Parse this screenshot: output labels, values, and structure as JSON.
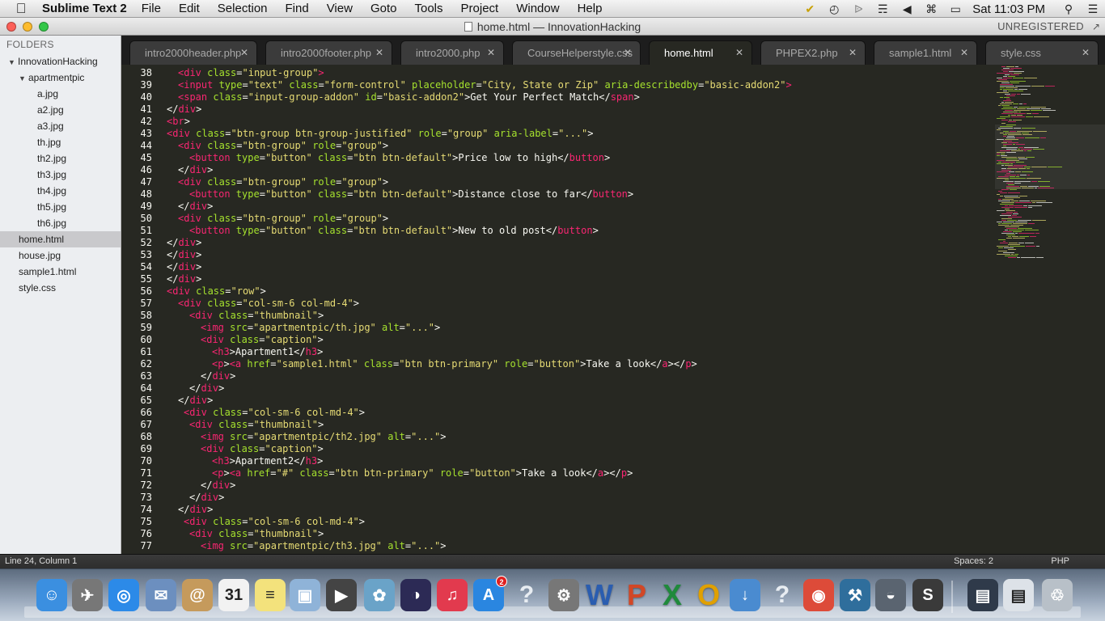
{
  "menubar": {
    "app_name": "Sublime Text 2",
    "items": [
      "File",
      "Edit",
      "Selection",
      "Find",
      "View",
      "Goto",
      "Tools",
      "Project",
      "Window",
      "Help"
    ],
    "clock": "Sat 11:03 PM"
  },
  "window": {
    "title": "home.html — InnovationHacking",
    "registration": "UNREGISTERED"
  },
  "sidebar": {
    "heading": "FOLDERS",
    "tree": [
      {
        "label": "InnovationHacking",
        "depth": 0,
        "expanded": true
      },
      {
        "label": "apartmentpic",
        "depth": 1,
        "expanded": true
      },
      {
        "label": "a.jpg",
        "depth": 2
      },
      {
        "label": "a2.jpg",
        "depth": 2
      },
      {
        "label": "a3.jpg",
        "depth": 2
      },
      {
        "label": "th.jpg",
        "depth": 2
      },
      {
        "label": "th2.jpg",
        "depth": 2
      },
      {
        "label": "th3.jpg",
        "depth": 2
      },
      {
        "label": "th4.jpg",
        "depth": 2
      },
      {
        "label": "th5.jpg",
        "depth": 2
      },
      {
        "label": "th6.jpg",
        "depth": 2
      },
      {
        "label": "home.html",
        "depth": 1,
        "selected": true
      },
      {
        "label": "house.jpg",
        "depth": 1
      },
      {
        "label": "sample1.html",
        "depth": 1
      },
      {
        "label": "style.css",
        "depth": 1
      }
    ]
  },
  "tabs": [
    {
      "label": "intro2000header.php"
    },
    {
      "label": "intro2000footer.php"
    },
    {
      "label": "intro2000.php"
    },
    {
      "label": "CourseHelperstyle.css"
    },
    {
      "label": "home.html",
      "active": true
    },
    {
      "label": "PHPEX2.php"
    },
    {
      "label": "sample1.html"
    },
    {
      "label": "style.css"
    }
  ],
  "code_lines": [
    {
      "n": "38",
      "indent": 2,
      "tokens": [
        [
          "tn",
          "<div"
        ],
        [
          "at",
          " class"
        ],
        [
          "tx",
          "="
        ],
        [
          "sv",
          "\"input-group\""
        ],
        [
          "tn",
          ">"
        ]
      ]
    },
    {
      "n": "39",
      "indent": 2,
      "tokens": [
        [
          "tn",
          "<input"
        ],
        [
          "at",
          " type"
        ],
        [
          "tx",
          "="
        ],
        [
          "sv",
          "\"text\""
        ],
        [
          "at",
          " class"
        ],
        [
          "tx",
          "="
        ],
        [
          "sv",
          "\"form-control\""
        ],
        [
          "at",
          " placeholder"
        ],
        [
          "tx",
          "="
        ],
        [
          "sv",
          "\"City, State or Zip\""
        ],
        [
          "at",
          " aria-describedby"
        ],
        [
          "tx",
          "="
        ],
        [
          "sv",
          "\"basic-addon2\""
        ],
        [
          "tn",
          ">"
        ]
      ]
    },
    {
      "n": "40",
      "indent": 2,
      "tokens": [
        [
          "tn",
          "<span"
        ],
        [
          "at",
          " class"
        ],
        [
          "tx",
          "="
        ],
        [
          "sv",
          "\"input-group-addon\""
        ],
        [
          "at",
          " id"
        ],
        [
          "tx",
          "="
        ],
        [
          "sv",
          "\"basic-addon2\""
        ],
        [
          "tx",
          ">Get Your Perfect Match</"
        ],
        [
          "tn",
          "span"
        ],
        [
          "tx",
          ">"
        ]
      ]
    },
    {
      "n": "41",
      "indent": 0,
      "tokens": [
        [
          "tx",
          "</"
        ],
        [
          "tn",
          "div"
        ],
        [
          "tx",
          ">"
        ]
      ]
    },
    {
      "n": "42",
      "indent": 0,
      "tokens": [
        [
          "tn",
          "<br"
        ],
        [
          "tx",
          ">"
        ]
      ]
    },
    {
      "n": "43",
      "indent": 0,
      "tokens": [
        [
          "tn",
          "<div"
        ],
        [
          "at",
          " class"
        ],
        [
          "tx",
          "="
        ],
        [
          "sv",
          "\"btn-group btn-group-justified\""
        ],
        [
          "at",
          " role"
        ],
        [
          "tx",
          "="
        ],
        [
          "sv",
          "\"group\""
        ],
        [
          "at",
          " aria-label"
        ],
        [
          "tx",
          "="
        ],
        [
          "sv",
          "\"...\""
        ],
        [
          "tx",
          ">"
        ]
      ]
    },
    {
      "n": "44",
      "indent": 2,
      "tokens": [
        [
          "tn",
          "<div"
        ],
        [
          "at",
          " class"
        ],
        [
          "tx",
          "="
        ],
        [
          "sv",
          "\"btn-group\""
        ],
        [
          "at",
          " role"
        ],
        [
          "tx",
          "="
        ],
        [
          "sv",
          "\"group\""
        ],
        [
          "tx",
          ">"
        ]
      ]
    },
    {
      "n": "45",
      "indent": 4,
      "tokens": [
        [
          "tn",
          "<button"
        ],
        [
          "at",
          " type"
        ],
        [
          "tx",
          "="
        ],
        [
          "sv",
          "\"button\""
        ],
        [
          "at",
          " class"
        ],
        [
          "tx",
          "="
        ],
        [
          "sv",
          "\"btn btn-default\""
        ],
        [
          "tx",
          ">Price low to high</"
        ],
        [
          "tn",
          "button"
        ],
        [
          "tx",
          ">"
        ]
      ]
    },
    {
      "n": "46",
      "indent": 2,
      "tokens": [
        [
          "tx",
          "</"
        ],
        [
          "tn",
          "div"
        ],
        [
          "tx",
          ">"
        ]
      ]
    },
    {
      "n": "47",
      "indent": 2,
      "tokens": [
        [
          "tn",
          "<div"
        ],
        [
          "at",
          " class"
        ],
        [
          "tx",
          "="
        ],
        [
          "sv",
          "\"btn-group\""
        ],
        [
          "at",
          " role"
        ],
        [
          "tx",
          "="
        ],
        [
          "sv",
          "\"group\""
        ],
        [
          "tx",
          ">"
        ]
      ]
    },
    {
      "n": "48",
      "indent": 4,
      "tokens": [
        [
          "tn",
          "<button"
        ],
        [
          "at",
          " type"
        ],
        [
          "tx",
          "="
        ],
        [
          "sv",
          "\"button\""
        ],
        [
          "at",
          " class"
        ],
        [
          "tx",
          "="
        ],
        [
          "sv",
          "\"btn btn-default\""
        ],
        [
          "tx",
          ">Distance close to far</"
        ],
        [
          "tn",
          "button"
        ],
        [
          "tx",
          ">"
        ]
      ]
    },
    {
      "n": "49",
      "indent": 2,
      "tokens": [
        [
          "tx",
          "</"
        ],
        [
          "tn",
          "div"
        ],
        [
          "tx",
          ">"
        ]
      ]
    },
    {
      "n": "50",
      "indent": 2,
      "tokens": [
        [
          "tn",
          "<div"
        ],
        [
          "at",
          " class"
        ],
        [
          "tx",
          "="
        ],
        [
          "sv",
          "\"btn-group\""
        ],
        [
          "at",
          " role"
        ],
        [
          "tx",
          "="
        ],
        [
          "sv",
          "\"group\""
        ],
        [
          "tx",
          ">"
        ]
      ]
    },
    {
      "n": "51",
      "indent": 4,
      "tokens": [
        [
          "tn",
          "<button"
        ],
        [
          "at",
          " type"
        ],
        [
          "tx",
          "="
        ],
        [
          "sv",
          "\"button\""
        ],
        [
          "at",
          " class"
        ],
        [
          "tx",
          "="
        ],
        [
          "sv",
          "\"btn btn-default\""
        ],
        [
          "tx",
          ">New to old post</"
        ],
        [
          "tn",
          "button"
        ],
        [
          "tx",
          ">"
        ]
      ]
    },
    {
      "n": "52",
      "indent": 0,
      "tokens": [
        [
          "tx",
          "</"
        ],
        [
          "tn",
          "div"
        ],
        [
          "tx",
          ">"
        ]
      ]
    },
    {
      "n": "53",
      "indent": 0,
      "tokens": [
        [
          "tx",
          "</"
        ],
        [
          "tn",
          "div"
        ],
        [
          "tx",
          ">"
        ]
      ]
    },
    {
      "n": "54",
      "indent": 0,
      "tokens": [
        [
          "tx",
          "</"
        ],
        [
          "tn",
          "div"
        ],
        [
          "tx",
          ">"
        ]
      ]
    },
    {
      "n": "55",
      "indent": 0,
      "tokens": [
        [
          "tx",
          "</"
        ],
        [
          "tn",
          "div"
        ],
        [
          "tx",
          ">"
        ]
      ]
    },
    {
      "n": "56",
      "indent": 0,
      "tokens": [
        [
          "tn",
          "<div"
        ],
        [
          "at",
          " class"
        ],
        [
          "tx",
          "="
        ],
        [
          "sv",
          "\"row\""
        ],
        [
          "tx",
          ">"
        ]
      ]
    },
    {
      "n": "57",
      "indent": 2,
      "tokens": [
        [
          "tn",
          "<div"
        ],
        [
          "at",
          " class"
        ],
        [
          "tx",
          "="
        ],
        [
          "sv",
          "\"col-sm-6 col-md-4\""
        ],
        [
          "tx",
          ">"
        ]
      ]
    },
    {
      "n": "58",
      "indent": 4,
      "tokens": [
        [
          "tn",
          "<div"
        ],
        [
          "at",
          " class"
        ],
        [
          "tx",
          "="
        ],
        [
          "sv",
          "\"thumbnail\""
        ],
        [
          "tx",
          ">"
        ]
      ]
    },
    {
      "n": "59",
      "indent": 6,
      "tokens": [
        [
          "tn",
          "<img"
        ],
        [
          "at",
          " src"
        ],
        [
          "tx",
          "="
        ],
        [
          "sv",
          "\"apartmentpic/th.jpg\""
        ],
        [
          "at",
          " alt"
        ],
        [
          "tx",
          "="
        ],
        [
          "sv",
          "\"...\""
        ],
        [
          "tx",
          ">"
        ]
      ]
    },
    {
      "n": "60",
      "indent": 6,
      "tokens": [
        [
          "tn",
          "<div"
        ],
        [
          "at",
          " class"
        ],
        [
          "tx",
          "="
        ],
        [
          "sv",
          "\"caption\""
        ],
        [
          "tx",
          ">"
        ]
      ]
    },
    {
      "n": "61",
      "indent": 8,
      "tokens": [
        [
          "tn",
          "<h3"
        ],
        [
          "tx",
          ">Apartment1</"
        ],
        [
          "tn",
          "h3"
        ],
        [
          "tx",
          ">"
        ]
      ]
    },
    {
      "n": "62",
      "indent": 8,
      "tokens": [
        [
          "tn",
          "<p"
        ],
        [
          "tx",
          ">"
        ],
        [
          "tn",
          "<a"
        ],
        [
          "at",
          " href"
        ],
        [
          "tx",
          "="
        ],
        [
          "sv",
          "\"sample1.html\""
        ],
        [
          "at",
          " class"
        ],
        [
          "tx",
          "="
        ],
        [
          "sv",
          "\"btn btn-primary\""
        ],
        [
          "at",
          " role"
        ],
        [
          "tx",
          "="
        ],
        [
          "sv",
          "\"button\""
        ],
        [
          "tx",
          ">Take a look</"
        ],
        [
          "tn",
          "a"
        ],
        [
          "tx",
          "></"
        ],
        [
          "tn",
          "p"
        ],
        [
          "tx",
          ">"
        ]
      ]
    },
    {
      "n": "63",
      "indent": 6,
      "tokens": [
        [
          "tx",
          "</"
        ],
        [
          "tn",
          "div"
        ],
        [
          "tx",
          ">"
        ]
      ]
    },
    {
      "n": "64",
      "indent": 4,
      "tokens": [
        [
          "tx",
          "</"
        ],
        [
          "tn",
          "div"
        ],
        [
          "tx",
          ">"
        ]
      ]
    },
    {
      "n": "65",
      "indent": 2,
      "tokens": [
        [
          "tx",
          "</"
        ],
        [
          "tn",
          "div"
        ],
        [
          "tx",
          ">"
        ]
      ]
    },
    {
      "n": "66",
      "indent": 3,
      "tokens": [
        [
          "tn",
          "<div"
        ],
        [
          "at",
          " class"
        ],
        [
          "tx",
          "="
        ],
        [
          "sv",
          "\"col-sm-6 col-md-4\""
        ],
        [
          "tx",
          ">"
        ]
      ]
    },
    {
      "n": "67",
      "indent": 4,
      "tokens": [
        [
          "tn",
          "<div"
        ],
        [
          "at",
          " class"
        ],
        [
          "tx",
          "="
        ],
        [
          "sv",
          "\"thumbnail\""
        ],
        [
          "tx",
          ">"
        ]
      ]
    },
    {
      "n": "68",
      "indent": 6,
      "tokens": [
        [
          "tn",
          "<img"
        ],
        [
          "at",
          " src"
        ],
        [
          "tx",
          "="
        ],
        [
          "sv",
          "\"apartmentpic/th2.jpg\""
        ],
        [
          "at",
          " alt"
        ],
        [
          "tx",
          "="
        ],
        [
          "sv",
          "\"...\""
        ],
        [
          "tx",
          ">"
        ]
      ]
    },
    {
      "n": "69",
      "indent": 6,
      "tokens": [
        [
          "tn",
          "<div"
        ],
        [
          "at",
          " class"
        ],
        [
          "tx",
          "="
        ],
        [
          "sv",
          "\"caption\""
        ],
        [
          "tx",
          ">"
        ]
      ]
    },
    {
      "n": "70",
      "indent": 8,
      "tokens": [
        [
          "tn",
          "<h3"
        ],
        [
          "tx",
          ">Apartment2</"
        ],
        [
          "tn",
          "h3"
        ],
        [
          "tx",
          ">"
        ]
      ]
    },
    {
      "n": "71",
      "indent": 8,
      "tokens": [
        [
          "tn",
          "<p"
        ],
        [
          "tx",
          ">"
        ],
        [
          "tn",
          "<a"
        ],
        [
          "at",
          " href"
        ],
        [
          "tx",
          "="
        ],
        [
          "sv",
          "\"#\""
        ],
        [
          "at",
          " class"
        ],
        [
          "tx",
          "="
        ],
        [
          "sv",
          "\"btn btn-primary\""
        ],
        [
          "at",
          " role"
        ],
        [
          "tx",
          "="
        ],
        [
          "sv",
          "\"button\""
        ],
        [
          "tx",
          ">Take a look</"
        ],
        [
          "tn",
          "a"
        ],
        [
          "tx",
          "></"
        ],
        [
          "tn",
          "p"
        ],
        [
          "tx",
          ">"
        ]
      ]
    },
    {
      "n": "72",
      "indent": 6,
      "tokens": [
        [
          "tx",
          "</"
        ],
        [
          "tn",
          "div"
        ],
        [
          "tx",
          ">"
        ]
      ]
    },
    {
      "n": "73",
      "indent": 4,
      "tokens": [
        [
          "tx",
          "</"
        ],
        [
          "tn",
          "div"
        ],
        [
          "tx",
          ">"
        ]
      ]
    },
    {
      "n": "74",
      "indent": 2,
      "tokens": [
        [
          "tx",
          "</"
        ],
        [
          "tn",
          "div"
        ],
        [
          "tx",
          ">"
        ]
      ]
    },
    {
      "n": "75",
      "indent": 3,
      "tokens": [
        [
          "tn",
          "<div"
        ],
        [
          "at",
          " class"
        ],
        [
          "tx",
          "="
        ],
        [
          "sv",
          "\"col-sm-6 col-md-4\""
        ],
        [
          "tx",
          ">"
        ]
      ]
    },
    {
      "n": "76",
      "indent": 4,
      "tokens": [
        [
          "tn",
          "<div"
        ],
        [
          "at",
          " class"
        ],
        [
          "tx",
          "="
        ],
        [
          "sv",
          "\"thumbnail\""
        ],
        [
          "tx",
          ">"
        ]
      ]
    },
    {
      "n": "77",
      "indent": 6,
      "tokens": [
        [
          "tn",
          "<img"
        ],
        [
          "at",
          " src"
        ],
        [
          "tx",
          "="
        ],
        [
          "sv",
          "\"apartmentpic/th3.jpg\""
        ],
        [
          "at",
          " alt"
        ],
        [
          "tx",
          "="
        ],
        [
          "sv",
          "\"...\""
        ],
        [
          "tx",
          ">"
        ]
      ]
    }
  ],
  "statusbar": {
    "position": "Line 24, Column 1",
    "indentation": "Spaces: 2",
    "syntax": "PHP"
  },
  "dock": {
    "app_store_badge": "2",
    "icons": [
      "finder-icon",
      "launchpad-icon",
      "safari-icon",
      "mail-icon",
      "contacts-icon",
      "calendar-icon",
      "notes-icon",
      "preview-icon",
      "facetime-icon",
      "iphoto-icon",
      "eclipse-icon",
      "itunes-icon",
      "app-store-icon",
      "unknown-app-icon",
      "system-preferences-icon",
      "word-icon",
      "powerpoint-icon",
      "excel-icon",
      "outlook-icon",
      "installer-icon",
      "unknown-app-icon",
      "chrome-icon",
      "mysql-workbench-icon",
      "sequel-pro-icon",
      "sublime-text-icon",
      "downloads-stack-icon",
      "documents-stack-icon",
      "trash-icon"
    ]
  },
  "colors": {
    "editor_bg": "#272822",
    "tag": "#f92672",
    "attribute": "#a6e22e",
    "string": "#e6db74",
    "text": "#f8f8f2"
  }
}
